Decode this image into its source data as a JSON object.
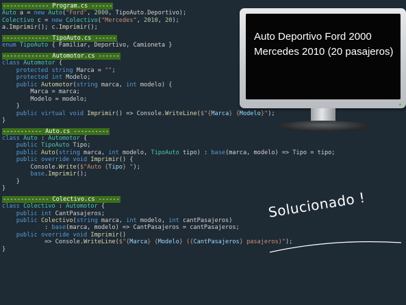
{
  "program": {
    "header": "------------- Program.cs ------",
    "l1": {
      "a": "Auto",
      "b": " a = ",
      "c": "new",
      "d": " ",
      "e": "Auto",
      "f": "(",
      "g": "\"Ford\"",
      "h": ", ",
      "i": "2000",
      "j": ", TipoAuto.Deportivo);"
    },
    "l2": {
      "a": "Colectivo",
      "b": " c = ",
      "c": "new",
      "d": " ",
      "e": "Colectivo",
      "f": "(",
      "g": "\"Mercedes\"",
      "h": ", ",
      "i": "2010",
      "j": ", ",
      "k": "20",
      "l": ");"
    },
    "l3": {
      "a": "a.",
      "b": "Imprimir",
      "c": "(); c.",
      "d": "Imprimir",
      "e": "();"
    }
  },
  "tipoauto": {
    "header": "------------- TipoAuto.cs ------",
    "l1": {
      "a": "enum",
      "b": " ",
      "c": "TipoAuto",
      "d": " { Familiar, Deportivo, Camioneta }"
    }
  },
  "automotor": {
    "header": "------------- Automotor.cs ------",
    "l1": {
      "a": "class",
      "b": " ",
      "c": "Automotor",
      "d": " {"
    },
    "l2": {
      "i": "    ",
      "a": "protected",
      "b": " ",
      "c": "string",
      "d": " Marca = ",
      "e": "\"\"",
      "f": ";"
    },
    "l3": {
      "i": "    ",
      "a": "protected",
      "b": " ",
      "c": "int",
      "d": " Modelo;"
    },
    "l4": {
      "i": "    ",
      "a": "public",
      "b": " ",
      "c": "Automotor",
      "d": "(",
      "e": "string",
      "f": " marca, ",
      "g": "int",
      "h": " modelo) {"
    },
    "l5": {
      "i": "        ",
      "a": "Marca",
      "b": " = marca;"
    },
    "l6": {
      "i": "        ",
      "a": "Modelo",
      "b": " = modelo;"
    },
    "l7": "    }",
    "l8": {
      "i": "    ",
      "a": "public",
      "b": " ",
      "c": "virtual",
      "d": " ",
      "e": "void",
      "f": " ",
      "g": "Imprimir",
      "h": "() => Console.",
      "j": "WriteLine",
      "k": "(",
      "l": "$\"{",
      "m": "Marca",
      "n": "} {",
      "o": "Modelo",
      "p": "}\"",
      "q": ");"
    },
    "l9": "}"
  },
  "auto": {
    "header": "----------- Auto.cs ----------",
    "l1": {
      "a": "class",
      "b": " ",
      "c": "Auto",
      "d": " : ",
      "e": "Automotor",
      "f": " {"
    },
    "l2": {
      "i": "    ",
      "a": "public",
      "b": " ",
      "c": "TipoAuto",
      "d": " Tipo;"
    },
    "l3": {
      "i": "    ",
      "a": "public",
      "b": " ",
      "c": "Auto",
      "d": "(",
      "e": "string",
      "f": " marca, ",
      "g": "int",
      "h": " modelo, ",
      "j": "TipoAuto",
      "k": " tipo) : ",
      "l": "base",
      "m": "(marca, modelo) => Tipo = tipo;"
    },
    "l4": {
      "i": "    ",
      "a": "public",
      "b": " ",
      "c": "override",
      "d": " ",
      "e": "void",
      "f": " ",
      "g": "Imprimir",
      "h": "() {"
    },
    "l5": {
      "i": "        ",
      "a": "Console.",
      "b": "Write",
      "c": "(",
      "d": "$\"Auto {",
      "e": "Tipo",
      "f": "} \"",
      "g": ");"
    },
    "l6": {
      "i": "        ",
      "a": "base",
      "b": ".",
      "c": "Imprimir",
      "d": "();"
    },
    "l7": "    }",
    "l8": "}"
  },
  "colectivo": {
    "header": "------------- Colectivo.cs ------",
    "l1": {
      "a": "class",
      "b": " ",
      "c": "Colectivo",
      "d": " : ",
      "e": "Automotor",
      "f": " {"
    },
    "l2": {
      "i": "    ",
      "a": "public",
      "b": " ",
      "c": "int",
      "d": " CantPasajeros;"
    },
    "l3": {
      "i": "    ",
      "a": "public",
      "b": " ",
      "c": "Colectivo",
      "d": "(",
      "e": "string",
      "f": " marca, ",
      "g": "int",
      "h": " modelo, ",
      "j": "int",
      "k": " cantPasajeros)"
    },
    "l4": {
      "i": "            : ",
      "a": "base",
      "b": "(marca, modelo) => CantPasajeros = cantPasajeros;"
    },
    "l5": {
      "i": "    ",
      "a": "public",
      "b": " ",
      "c": "override",
      "d": " ",
      "e": "void",
      "f": " ",
      "g": "Imprimir",
      "h": "()"
    },
    "l6": {
      "i": "            => Console.",
      "a": "WriteLine",
      "b": "(",
      "c": "$\"{",
      "d": "Marca",
      "e": "} {",
      "f": "Modelo",
      "g": "} ({",
      "h": "CantPasajeros",
      "j": "} pasajeros)\"",
      "k": ");"
    },
    "l7": "}"
  },
  "monitor": {
    "line1": "Auto Deportivo Ford 2000",
    "line2": "Mercedes 2010 (20 pasajeros)"
  },
  "annotation": "Solucionado !",
  "colors": {
    "header_bg": "#3b6e1c",
    "background": "#1e2a34",
    "keyword": "#569cd6",
    "type": "#4ec9b0",
    "method": "#dcdcaa",
    "string": "#ce9178"
  }
}
